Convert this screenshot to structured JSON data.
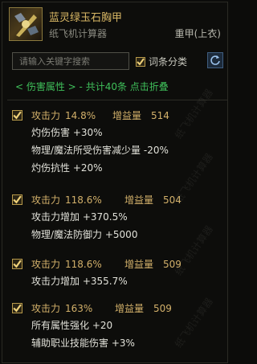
{
  "header": {
    "item_name": "蓝灵绿玉石胸甲",
    "tool_name": "纸飞机计算器",
    "slot": "重甲(上衣)"
  },
  "search": {
    "placeholder": "请输入关键字搜索",
    "value": ""
  },
  "group_toggle": {
    "label": "词条分类",
    "checked": true
  },
  "filter_bar": {
    "text": "< 伤害属性 > - 共计40条 点击折叠"
  },
  "watermark": "纸飞机计算器",
  "entries": [
    {
      "stat": "攻击力",
      "pct": "14.8%",
      "gain_label": "增益量",
      "gain_value": "514",
      "lines": [
        "灼伤伤害 +30%",
        "物理/魔法所受伤害减少量 -20%",
        "灼伤抗性 +20%"
      ]
    },
    {
      "stat": "攻击力",
      "pct": "118.6%",
      "gain_label": "增益量",
      "gain_value": "504",
      "lines": [
        "攻击力增加 +370.5%",
        "物理/魔法防御力 +5000"
      ]
    },
    {
      "stat": "攻击力",
      "pct": "118.6%",
      "gain_label": "增益量",
      "gain_value": "509",
      "lines": [
        "攻击力增加 +355.7%"
      ]
    },
    {
      "stat": "攻击力",
      "pct": "163%",
      "gain_label": "增益量",
      "gain_value": "509",
      "lines": [
        "所有属性强化 +20",
        "辅助职业技能伤害 +3%"
      ]
    }
  ]
}
